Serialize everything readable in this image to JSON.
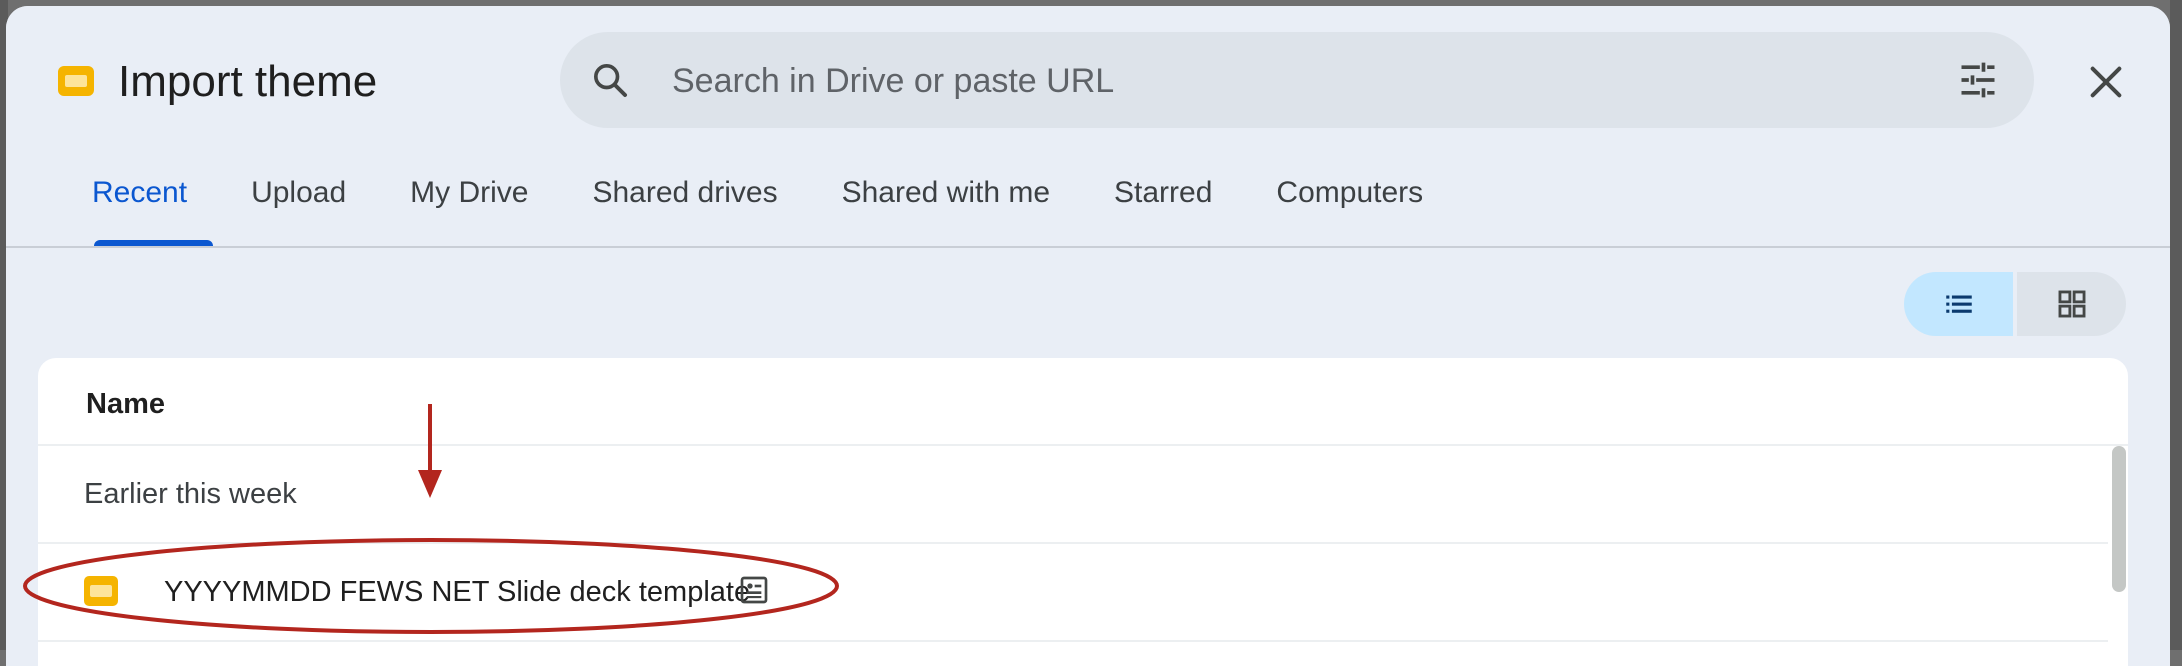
{
  "dialog": {
    "title": "Import theme",
    "app_icon": "google-slides-icon"
  },
  "search": {
    "placeholder": "Search in Drive or paste URL",
    "value": "",
    "icon": "search-icon",
    "filter_icon": "tune-icon"
  },
  "close_icon": "close-icon",
  "tabs": [
    {
      "label": "Recent",
      "active": true
    },
    {
      "label": "Upload",
      "active": false
    },
    {
      "label": "My Drive",
      "active": false
    },
    {
      "label": "Shared drives",
      "active": false
    },
    {
      "label": "Shared with me",
      "active": false
    },
    {
      "label": "Starred",
      "active": false
    },
    {
      "label": "Computers",
      "active": false
    }
  ],
  "view_toggle": {
    "list_icon": "list-view-icon",
    "grid_icon": "grid-view-icon",
    "selected": "list"
  },
  "file_list": {
    "column_header": "Name",
    "group_label": "Earlier this week",
    "files": [
      {
        "name": "YYYYMMDD FEWS NET Slide deck template",
        "type_icon": "google-slides-icon",
        "badge_icon": "template-icon"
      }
    ]
  },
  "colors": {
    "accent": "#0b57d0",
    "annotation": "#b3261e",
    "slides_yellow": "#f5b400"
  }
}
